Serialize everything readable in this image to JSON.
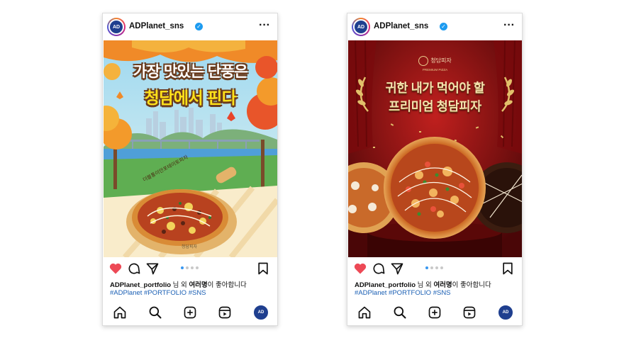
{
  "posts": [
    {
      "account_name": "ADPlanet_sns",
      "avatar_text": "AD",
      "liked_by_user": "ADPlanet_portfolio",
      "liked_by_suffix": " 님 외 ",
      "liked_by_others": "여러명",
      "liked_by_end": "이 좋아합니다",
      "hashtags": "#ADPlanet #PORTFOLIO #SNS",
      "image": {
        "headline_line1": "가장 맛있는 단풍은",
        "headline_line2": "청담에서 핀다",
        "pizza_label": "더블통이안포테이토피자",
        "brand_small": "청담피자"
      }
    },
    {
      "account_name": "ADPlanet_sns",
      "avatar_text": "AD",
      "liked_by_user": "ADPlanet_portfolio",
      "liked_by_suffix": " 님 외 ",
      "liked_by_others": "여러명",
      "liked_by_end": "이 좋아합니다",
      "hashtags": "#ADPlanet #PORTFOLIO #SNS",
      "image": {
        "brand_name": "청담피자",
        "brand_sub": "PREMIUM PIZZA",
        "headline_line1": "귀한 내가 먹어야 할",
        "headline_line2": "프리미엄 청담피자"
      }
    }
  ],
  "icons": {
    "like": "heart-icon",
    "comment": "comment-icon",
    "share": "share-icon",
    "save": "bookmark-icon",
    "more": "more-icon",
    "verified": "verified-badge-icon",
    "home": "home-icon",
    "search": "search-icon",
    "add": "add-icon",
    "reels": "reels-icon"
  },
  "colors": {
    "like_red": "#ed4956",
    "hashtag_blue": "#1a5fb4",
    "verified_blue": "#1d9bf0",
    "active_dot": "#3897f0"
  }
}
